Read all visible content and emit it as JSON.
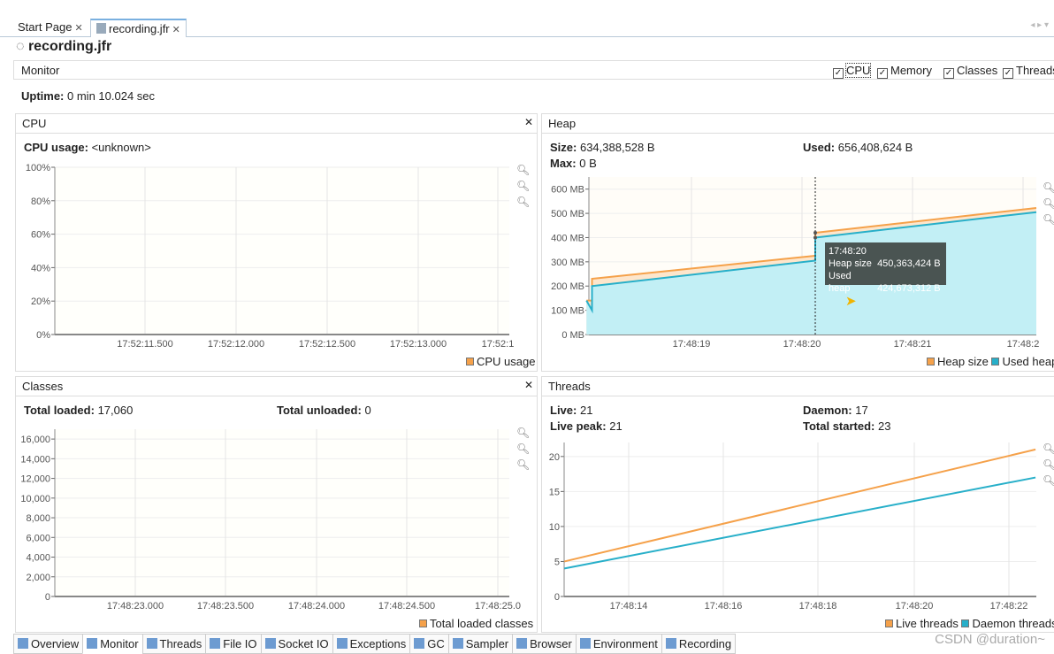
{
  "tabs": [
    {
      "label": "Start Page",
      "active": false
    },
    {
      "label": "recording.jfr",
      "active": true
    }
  ],
  "title": "recording.jfr",
  "monitor": {
    "label": "Monitor",
    "uptime_label": "Uptime:",
    "uptime_value": "0 min 10.024 sec",
    "checkboxes": [
      {
        "label": "CPU",
        "checked": true
      },
      {
        "label": "Memory",
        "checked": true
      },
      {
        "label": "Classes",
        "checked": true
      },
      {
        "label": "Threads",
        "checked": true
      }
    ]
  },
  "cpu": {
    "title": "CPU",
    "usage_label": "CPU usage:",
    "usage_value": "<unknown>"
  },
  "heap": {
    "title": "Heap",
    "size_label": "Size:",
    "size_value": "634,388,528 B",
    "used_label": "Used:",
    "used_value": "656,408,624 B",
    "max_label": "Max:",
    "max_value": "0 B",
    "tooltip": {
      "time": "17:48:20",
      "heap_size_label": "Heap size",
      "heap_size_value": "450,363,424 B",
      "used_heap_label": "Used heap",
      "used_heap_value": "424,673,312 B"
    }
  },
  "classes": {
    "title": "Classes",
    "loaded_label": "Total loaded:",
    "loaded_value": "17,060",
    "unloaded_label": "Total unloaded:",
    "unloaded_value": "0"
  },
  "threads": {
    "title": "Threads",
    "live_label": "Live:",
    "live_value": "21",
    "daemon_label": "Daemon:",
    "daemon_value": "17",
    "peak_label": "Live peak:",
    "peak_value": "21",
    "started_label": "Total started:",
    "started_value": "23"
  },
  "chart_data": [
    {
      "type": "line",
      "id": "cpu",
      "yticks": [
        "0%",
        "20%",
        "40%",
        "60%",
        "80%",
        "100%"
      ],
      "ylim": [
        0,
        100
      ],
      "xticks": [
        "17:52:11.500",
        "17:52:12.000",
        "17:52:12.500",
        "17:52:13.000",
        "17:52:1"
      ],
      "series": [
        {
          "name": "CPU usage",
          "color": "#f5a14a",
          "values": []
        }
      ],
      "legend": "bottom-right",
      "grid": true
    },
    {
      "type": "area",
      "id": "heap",
      "yticks": [
        "0 MB",
        "100 MB",
        "200 MB",
        "300 MB",
        "400 MB",
        "500 MB",
        "600 MB"
      ],
      "ylim": [
        0,
        650
      ],
      "xticks": [
        "17:48:19",
        "17:48:20",
        "17:48:21",
        "17:48:2"
      ],
      "x_unit": "seconds after 17:48",
      "series": [
        {
          "name": "Heap size",
          "color": "#f5a14a",
          "points": [
            [
              18.05,
              140
            ],
            [
              18.1,
              140
            ],
            [
              18.1,
              230
            ],
            [
              20.12,
              325
            ],
            [
              20.12,
              420
            ],
            [
              22.12,
              522
            ]
          ]
        },
        {
          "name": "Used heap",
          "color": "#27afc9",
          "points": [
            [
              18.05,
              140
            ],
            [
              18.1,
              100
            ],
            [
              18.1,
              200
            ],
            [
              20.12,
              305
            ],
            [
              20.12,
              400
            ],
            [
              22.12,
              505
            ]
          ]
        }
      ],
      "legend": "bottom-right",
      "grid": true
    },
    {
      "type": "line",
      "id": "classes",
      "yticks": [
        "0",
        "2,000",
        "4,000",
        "6,000",
        "8,000",
        "10,000",
        "12,000",
        "14,000",
        "16,000"
      ],
      "ylim": [
        0,
        17000
      ],
      "xticks": [
        "17:48:23.000",
        "17:48:23.500",
        "17:48:24.000",
        "17:48:24.500",
        "17:48:25.0"
      ],
      "series": [
        {
          "name": "Total loaded classes",
          "color": "#f5a14a",
          "values": []
        }
      ],
      "legend": "bottom-right",
      "grid": true
    },
    {
      "type": "line",
      "id": "threads",
      "yticks": [
        "0",
        "5",
        "10",
        "15",
        "20"
      ],
      "ylim": [
        0,
        22
      ],
      "xticks": [
        "17:48:14",
        "17:48:16",
        "17:48:18",
        "17:48:20",
        "17:48:22"
      ],
      "series": [
        {
          "name": "Live threads",
          "color": "#f5a14a",
          "points": [
            [
              12.64,
              5
            ],
            [
              22.6,
              21
            ]
          ]
        },
        {
          "name": "Daemon threads",
          "color": "#27afc9",
          "points": [
            [
              12.64,
              4
            ],
            [
              22.6,
              17
            ]
          ]
        }
      ],
      "legend": "bottom-right",
      "grid": true
    }
  ],
  "bottom_tabs": [
    "Overview",
    "Monitor",
    "Threads",
    "File IO",
    "Socket IO",
    "Exceptions",
    "GC",
    "Sampler",
    "Browser",
    "Environment",
    "Recording"
  ],
  "watermark": "CSDN @duration~"
}
